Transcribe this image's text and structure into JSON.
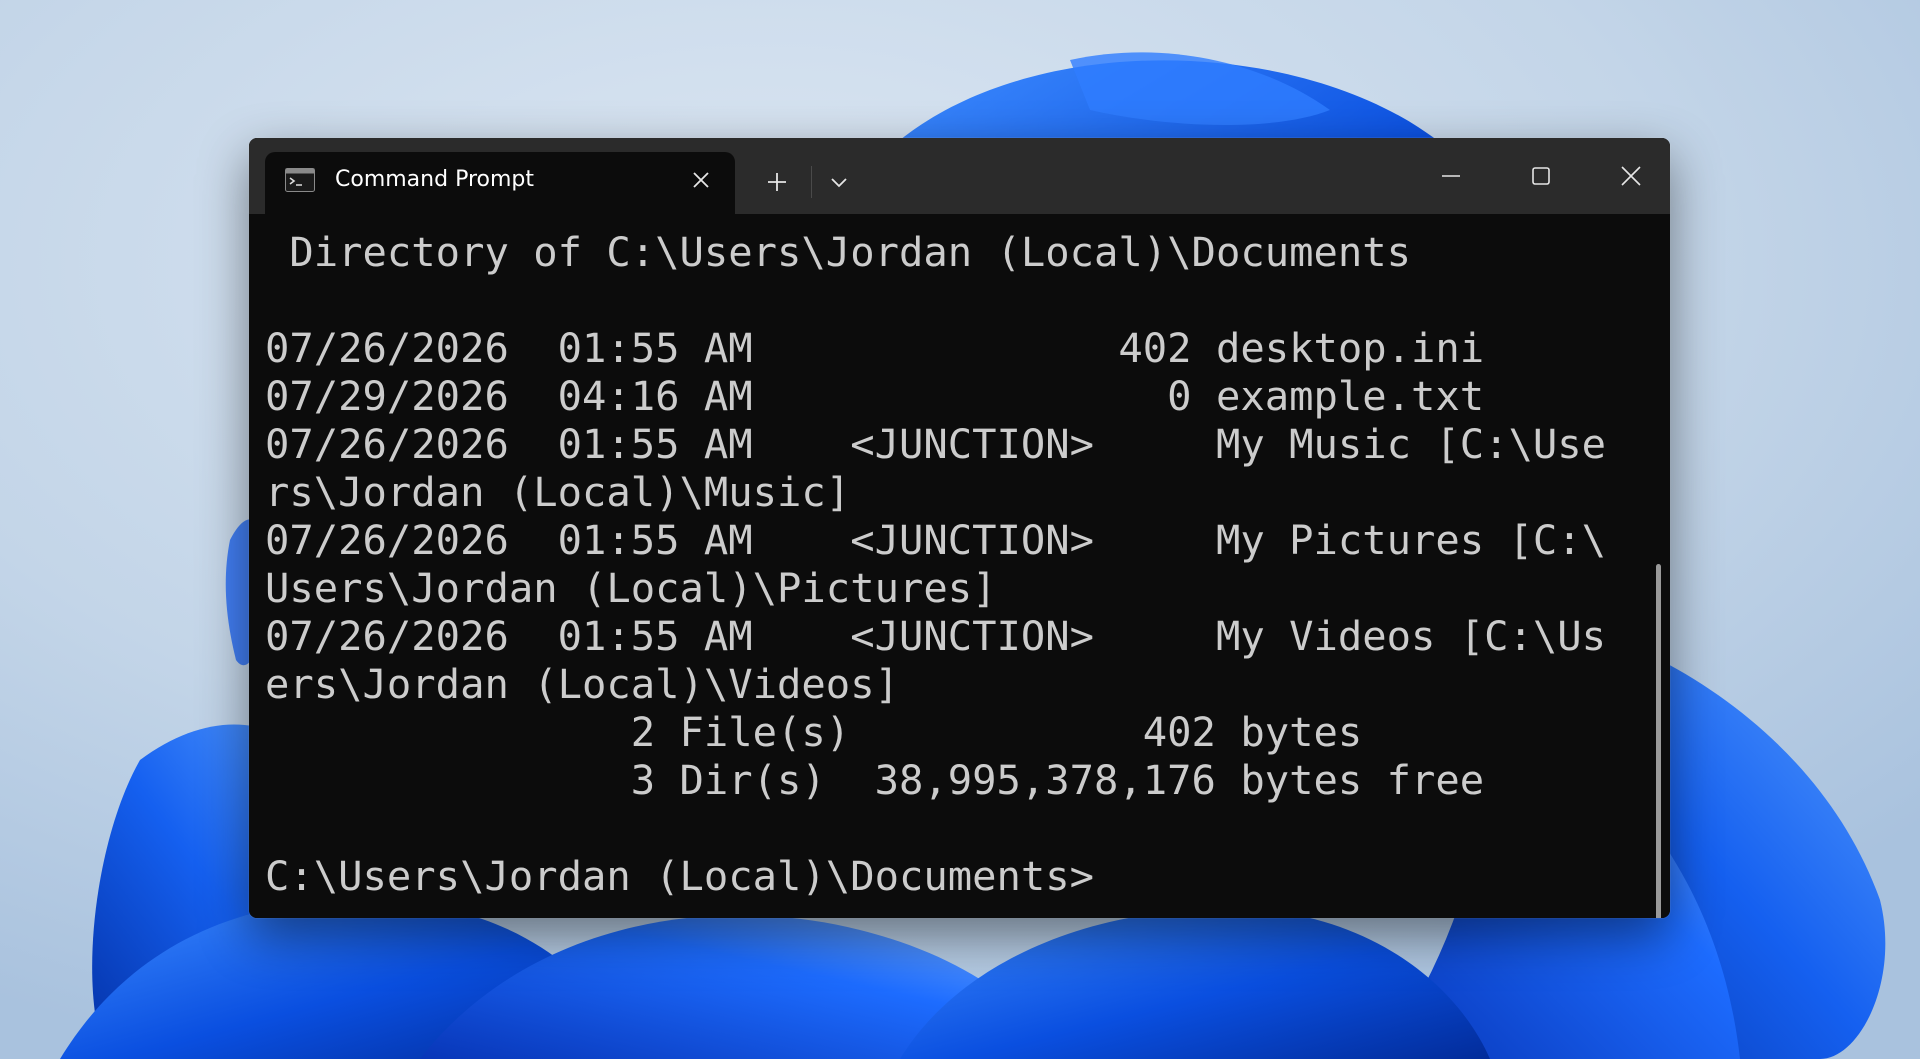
{
  "window": {
    "tab_title": "Command Prompt"
  },
  "icons": {
    "tab_app_icon": "command-prompt-icon",
    "tab_close": "close-icon",
    "new_tab": "plus-icon",
    "dropdown": "chevron-down-icon",
    "minimize": "minimize-icon",
    "maximize": "maximize-icon",
    "close": "close-icon"
  },
  "colors": {
    "console_bg": "#0c0c0c",
    "console_text": "#cccccc",
    "titlebar_bg": "#2b2b2b"
  },
  "console": {
    "lines": [
      " Directory of C:\\Users\\Jordan (Local)\\Documents",
      "",
      "07/26/2026  01:55 AM               402 desktop.ini",
      "07/29/2026  04:16 AM                 0 example.txt",
      "07/26/2026  01:55 AM    <JUNCTION>     My Music [C:\\Use",
      "rs\\Jordan (Local)\\Music]",
      "07/26/2026  01:55 AM    <JUNCTION>     My Pictures [C:\\",
      "Users\\Jordan (Local)\\Pictures]",
      "07/26/2026  01:55 AM    <JUNCTION>     My Videos [C:\\Us",
      "ers\\Jordan (Local)\\Videos]",
      "               2 File(s)            402 bytes",
      "               3 Dir(s)  38,995,378,176 bytes free",
      "",
      "C:\\Users\\Jordan (Local)\\Documents>"
    ]
  }
}
